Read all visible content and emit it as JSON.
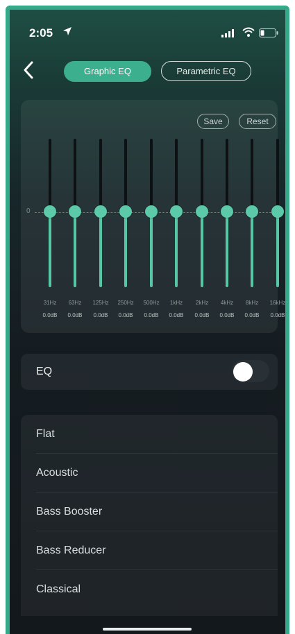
{
  "status": {
    "time": "2:05"
  },
  "header": {
    "tabs": [
      {
        "label": "Graphic EQ"
      },
      {
        "label": "Parametric EQ"
      }
    ]
  },
  "eq_panel": {
    "save_label": "Save",
    "reset_label": "Reset",
    "zero_label": "0",
    "bands": [
      {
        "freq": "31Hz",
        "gain": "0.0dB",
        "level": 0
      },
      {
        "freq": "63Hz",
        "gain": "0.0dB",
        "level": 0
      },
      {
        "freq": "125Hz",
        "gain": "0.0dB",
        "level": 0
      },
      {
        "freq": "250Hz",
        "gain": "0.0dB",
        "level": 0
      },
      {
        "freq": "500Hz",
        "gain": "0.0dB",
        "level": 0
      },
      {
        "freq": "1kHz",
        "gain": "0.0dB",
        "level": 0
      },
      {
        "freq": "2kHz",
        "gain": "0.0dB",
        "level": 0
      },
      {
        "freq": "4kHz",
        "gain": "0.0dB",
        "level": 0
      },
      {
        "freq": "8kHz",
        "gain": "0.0dB",
        "level": 0
      },
      {
        "freq": "16kHz",
        "gain": "0.0dB",
        "level": 0
      }
    ]
  },
  "eq_toggle": {
    "label": "EQ",
    "on": false
  },
  "presets": [
    {
      "label": "Flat"
    },
    {
      "label": "Acoustic"
    },
    {
      "label": "Bass Booster"
    },
    {
      "label": "Bass Reducer"
    },
    {
      "label": "Classical"
    }
  ],
  "colors": {
    "accent": "#3cb08e",
    "frame": "#37a98b",
    "background": "#151c21"
  }
}
